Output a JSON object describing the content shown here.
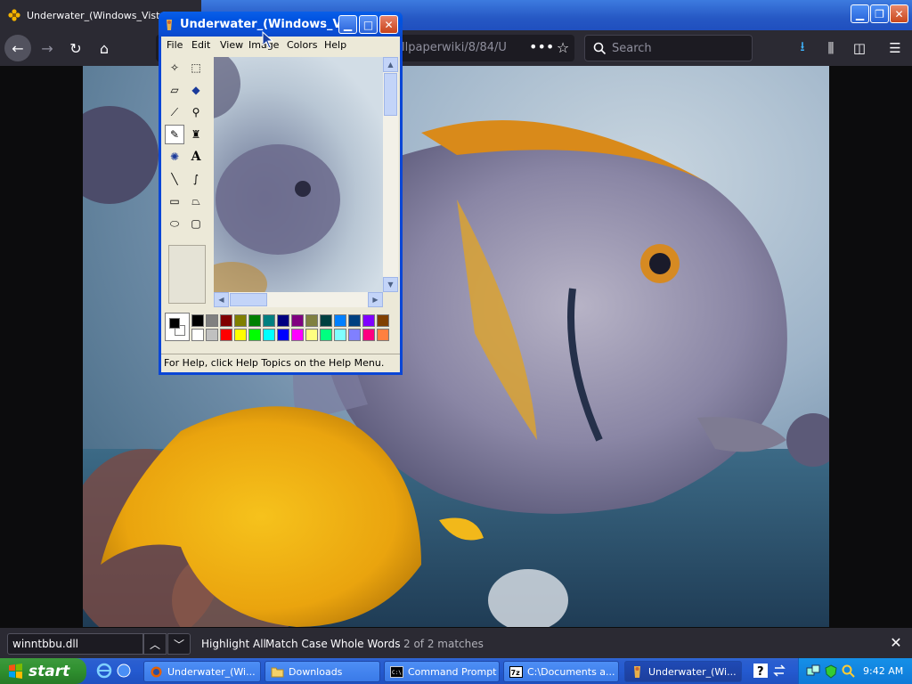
{
  "firefox": {
    "tab_title": "Underwater_(Windows_Vista_E",
    "url_text": "llpaperwiki/8/84/U",
    "search_placeholder": "Search",
    "icons": [
      "back-icon",
      "forward-icon",
      "reload-icon",
      "home-icon",
      "more-actions-icon",
      "bookmark-star-icon",
      "search-icon",
      "download-icon",
      "library-icon",
      "sidebar-icon",
      "menu-icon"
    ]
  },
  "findbar": {
    "query": "winntbbu.dll",
    "highlight_all": "Highlight All",
    "match_case": "Match Case",
    "whole_words": "Whole Words",
    "status": "2 of 2 matches"
  },
  "paint": {
    "title": "Underwater_(Windows_V...",
    "menu": [
      "File",
      "Edit",
      "View",
      "Image",
      "Colors",
      "Help"
    ],
    "status": "For Help, click Help Topics on the Help Menu.",
    "tools": [
      "free-form-select",
      "select",
      "eraser",
      "fill-with-color",
      "pick-color",
      "magnifier",
      "pencil",
      "brush",
      "airbrush",
      "text",
      "line",
      "curve",
      "rectangle",
      "polygon",
      "ellipse",
      "rounded-rectangle"
    ],
    "palette_top": [
      "#000000",
      "#808080",
      "#800000",
      "#808000",
      "#008000",
      "#008080",
      "#000080",
      "#800080",
      "#808040",
      "#004040",
      "#0080ff",
      "#004080",
      "#8000ff",
      "#804000"
    ],
    "palette_bottom": [
      "#ffffff",
      "#c0c0c0",
      "#ff0000",
      "#ffff00",
      "#00ff00",
      "#00ffff",
      "#0000ff",
      "#ff00ff",
      "#ffff80",
      "#00ff80",
      "#80ffff",
      "#8080ff",
      "#ff0080",
      "#ff8040"
    ],
    "foreground_color": "#000000",
    "background_color": "#ffffff"
  },
  "taskbar": {
    "start_label": "start",
    "items": [
      {
        "label": "Underwater_(Wi...",
        "icon": "firefox-icon"
      },
      {
        "label": "Downloads",
        "icon": "folder-icon"
      },
      {
        "label": "Command Prompt",
        "icon": "cmd-icon"
      },
      {
        "label": "C:\\Documents a...",
        "icon": "7zip-icon"
      },
      {
        "label": "Underwater_(Wi...",
        "icon": "paint-icon"
      }
    ],
    "clock": "9:42 AM"
  }
}
